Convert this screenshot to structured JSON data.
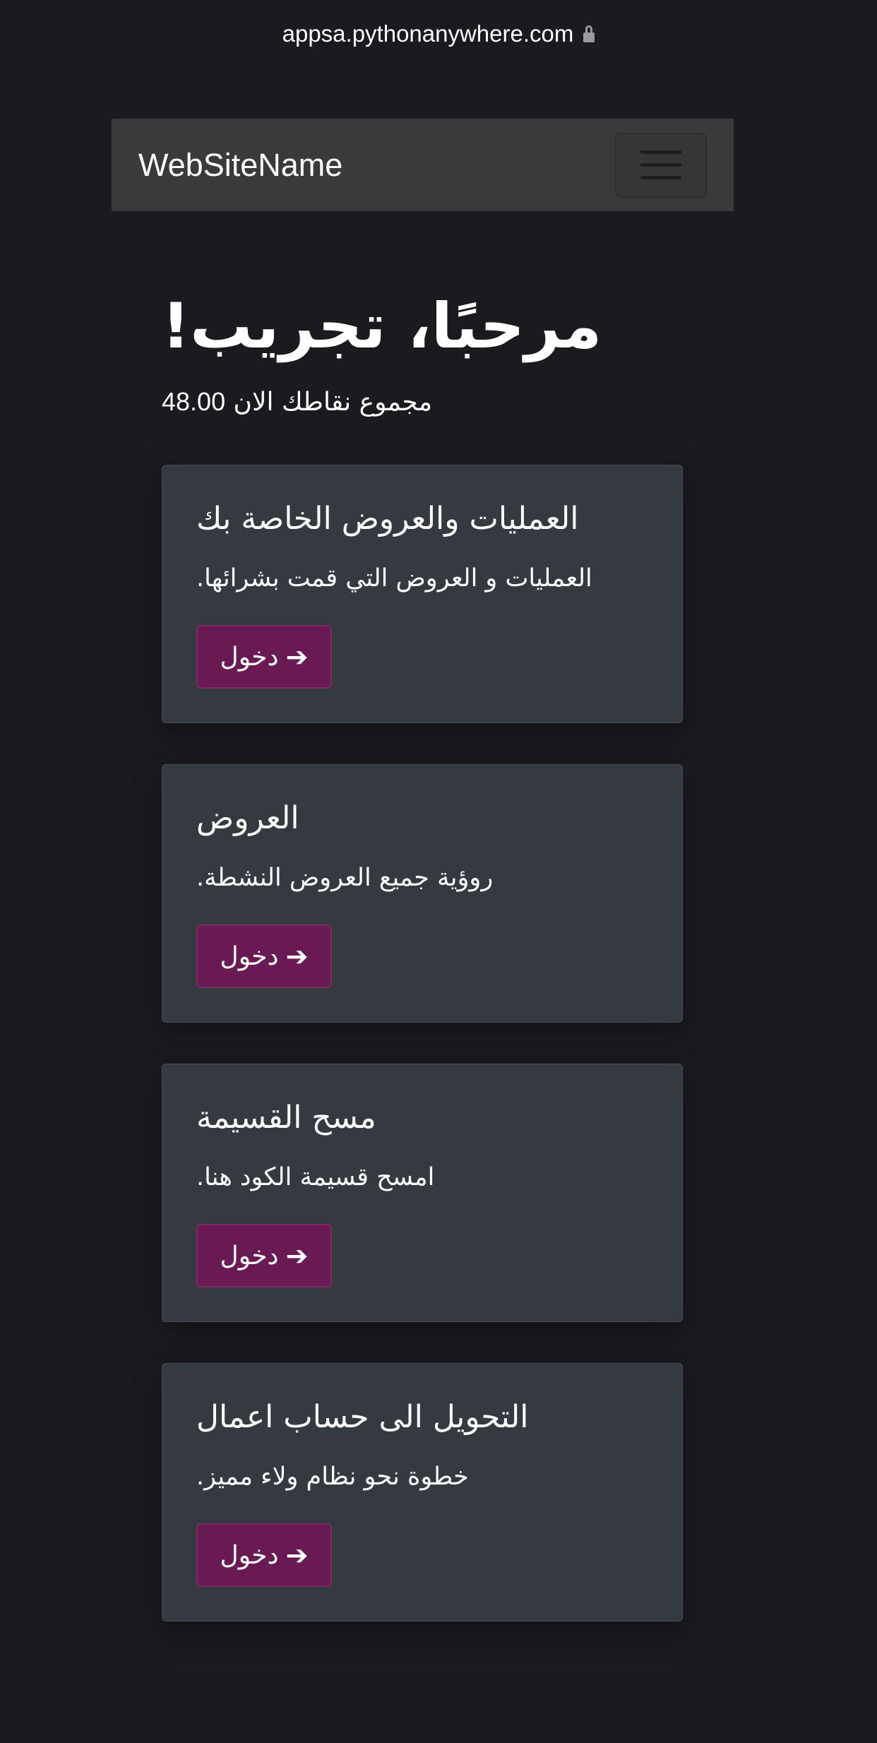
{
  "browser": {
    "url": "appsa.pythonanywhere.com",
    "lock_icon": "lock-icon"
  },
  "navbar": {
    "brand": "WebSiteName",
    "toggler_icon": "hamburger-icon"
  },
  "main": {
    "welcome": "مرحبًا، تجريب!",
    "points_label": "مجموع نقاطك الان",
    "points_value": "48.00"
  },
  "cards": [
    {
      "title": "العمليات والعروض الخاصة بك",
      "text": "العمليات و العروض التي قمت بشرائها.",
      "button_label": "دخول",
      "button_icon": "arrow-right-icon"
    },
    {
      "title": "العروض",
      "text": "روؤية جميع العروض النشطة.",
      "button_label": "دخول",
      "button_icon": "arrow-right-icon"
    },
    {
      "title": "مسح القسيمة",
      "text": "امسح قسيمة الكود هنا.",
      "button_label": "دخول",
      "button_icon": "arrow-right-icon"
    },
    {
      "title": "التحويل الى حساب اعمال",
      "text": "خطوة نحو نظام ولاء مميز.",
      "button_label": "دخول",
      "button_icon": "arrow-right-icon"
    }
  ],
  "colors": {
    "background": "#1b1b1f",
    "navbar": "#3a3a3a",
    "card": "#343a40",
    "button": "#6a1a52"
  }
}
